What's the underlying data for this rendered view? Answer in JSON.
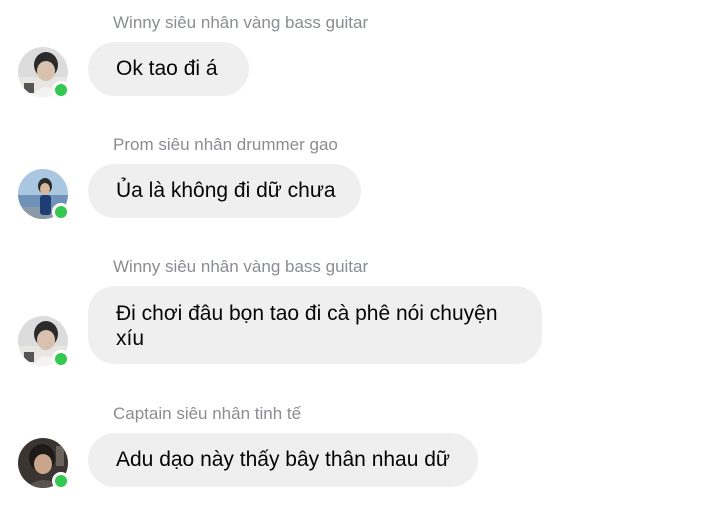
{
  "messages": [
    {
      "sender": "Winny siêu nhân vàng bass guitar",
      "text": "Ok tao đi á",
      "online": true
    },
    {
      "sender": "Prom siêu nhân drummer gao",
      "text": "Ủa là không đi dữ chưa",
      "online": true
    },
    {
      "sender": "Winny siêu nhân vàng bass guitar",
      "text": "Đi chơi đâu bọn tao đi cà phê nói chuyện xíu",
      "online": true
    },
    {
      "sender": "Captain siêu nhân tinh tế",
      "text": "Adu dạo này thấy bây thân nhau dữ",
      "online": true
    }
  ],
  "colors": {
    "bubble": "#efefef",
    "sender_text": "#8a8d91",
    "message_text": "#050505",
    "online_dot": "#31c94e"
  }
}
